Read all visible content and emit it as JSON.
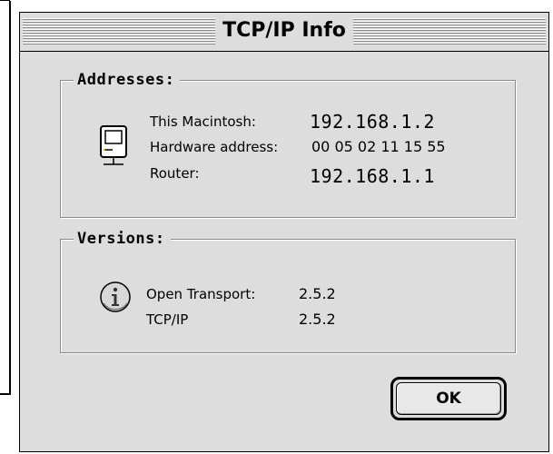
{
  "window": {
    "title": "TCP/IP Info"
  },
  "addresses": {
    "label": "Addresses:",
    "this_mac_label": "This Macintosh:",
    "this_mac_value": "192.168.1.2",
    "hardware_label": "Hardware address:",
    "hardware_value": "00 05 02 11 15 55",
    "router_label": "Router:",
    "router_value": "192.168.1.1"
  },
  "versions": {
    "label": "Versions:",
    "open_transport_label": "Open Transport:",
    "open_transport_value": "2.5.2",
    "tcpip_label": "TCP/IP",
    "tcpip_value": "2.5.2"
  },
  "buttons": {
    "ok_label": "OK"
  },
  "icons": {
    "computer": "macintosh-computer-icon",
    "info": "info-icon"
  },
  "colors": {
    "dialog_bg": "#dddddd",
    "frame": "#8a8a8a"
  }
}
